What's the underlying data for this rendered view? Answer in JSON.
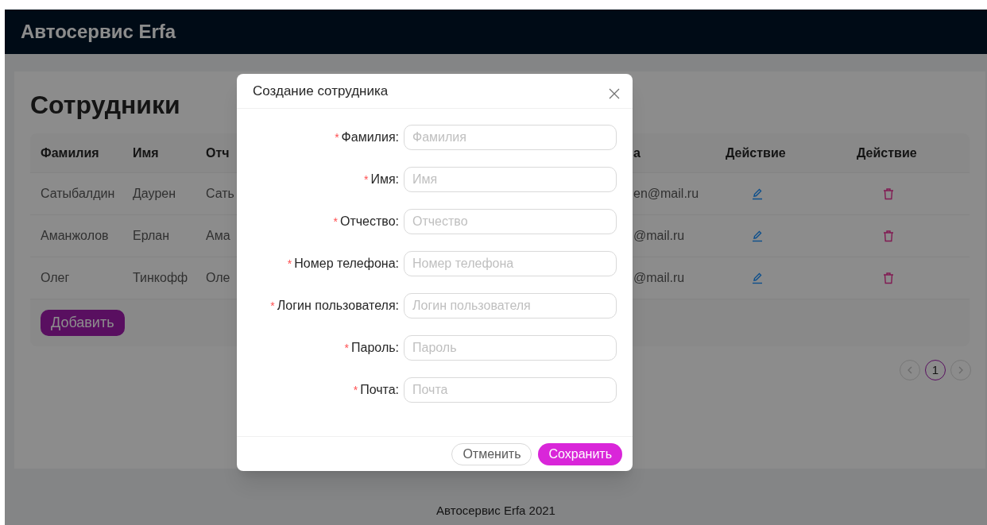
{
  "header": {
    "title": "Автосервис Erfa"
  },
  "page": {
    "title": "Сотрудники"
  },
  "table": {
    "columns_left": [
      "Фамилия",
      "Имя",
      "Отч"
    ],
    "columns_right": [
      "а",
      "Действие",
      "Действие"
    ],
    "rows": [
      {
        "left": [
          "Сатыбалдин",
          "Даурен",
          "Сать"
        ],
        "right": "en@mail.ru"
      },
      {
        "left": [
          "Аманжолов",
          "Ерлан",
          "Ама"
        ],
        "right": "@mail.ru"
      },
      {
        "left": [
          "Олег",
          "Тинкофф",
          "Оле"
        ],
        "right": "@mail.ru"
      }
    ],
    "add_button": "Добавить"
  },
  "pagination": {
    "pages": [
      {
        "label": "1",
        "selected": true
      }
    ]
  },
  "modal": {
    "title": "Создание сотрудника",
    "fields": [
      {
        "required_mark": "*",
        "label": "Фамилия:",
        "placeholder": "Фамилия"
      },
      {
        "required_mark": "*",
        "label": "Имя:",
        "placeholder": "Имя"
      },
      {
        "required_mark": "*",
        "label": "Отчество:",
        "placeholder": "Отчество"
      },
      {
        "required_mark": "*",
        "label": "Номер телефона:",
        "placeholder": "Номер телефона"
      },
      {
        "required_mark": "*",
        "label": "Логин пользователя:",
        "placeholder": "Логин пользователя"
      },
      {
        "required_mark": "*",
        "label": "Пароль:",
        "placeholder": "Пароль"
      },
      {
        "required_mark": "*",
        "label": "Почта:",
        "placeholder": "Почта"
      }
    ],
    "buttons": [
      {
        "label": "Отменить",
        "kind": "default"
      },
      {
        "label": "Сохранить",
        "kind": "primary"
      }
    ]
  },
  "footer": {
    "text": "Автосервис Erfa 2021"
  }
}
